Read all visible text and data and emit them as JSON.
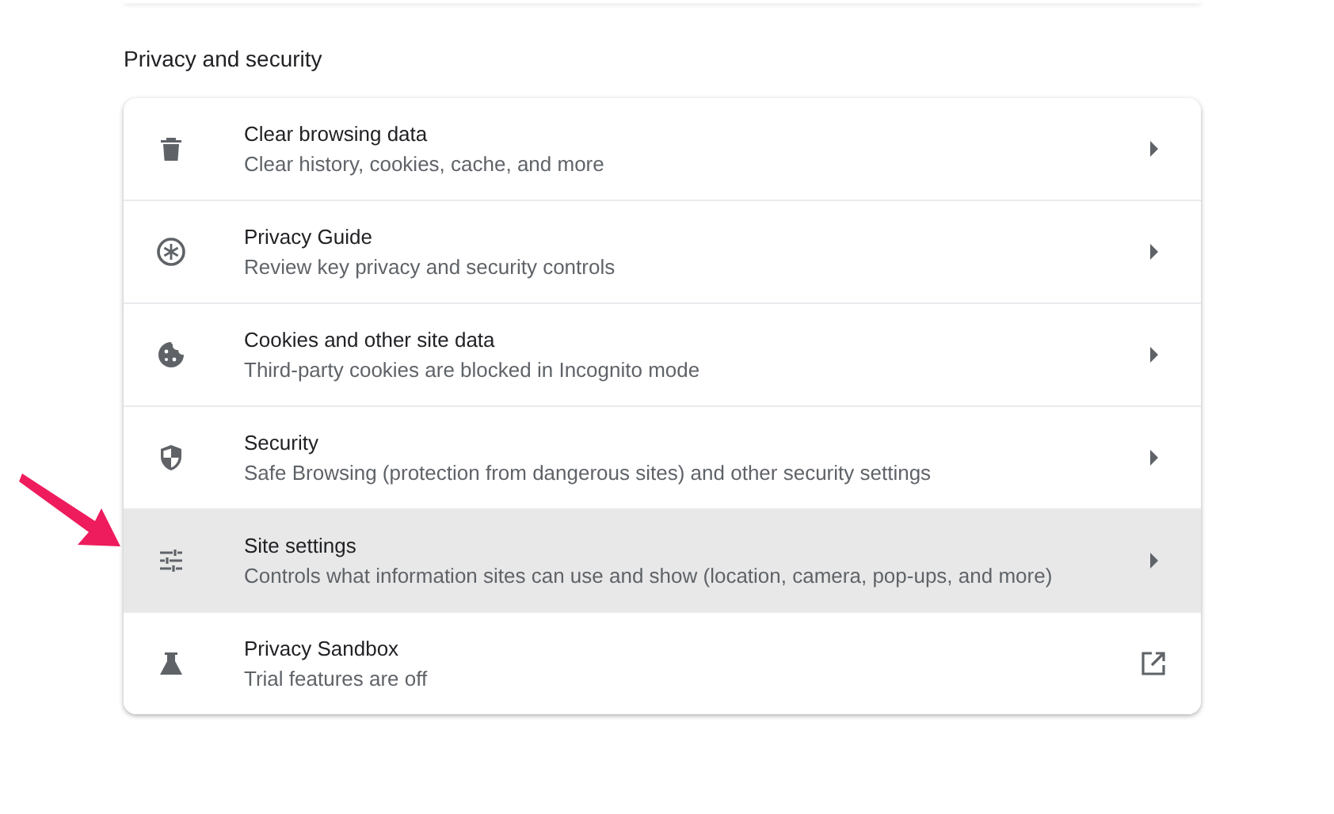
{
  "section": {
    "title": "Privacy and security"
  },
  "items": [
    {
      "kind": "subpage",
      "title": "Clear browsing data",
      "subtitle": "Clear history, cookies, cache, and more",
      "selected": false
    },
    {
      "kind": "subpage",
      "title": "Privacy Guide",
      "subtitle": "Review key privacy and security controls",
      "selected": false
    },
    {
      "kind": "subpage",
      "title": "Cookies and other site data",
      "subtitle": "Third-party cookies are blocked in Incognito mode",
      "selected": false
    },
    {
      "kind": "subpage",
      "title": "Security",
      "subtitle": "Safe Browsing (protection from dangerous sites) and other security settings",
      "selected": false
    },
    {
      "kind": "subpage",
      "title": "Site settings",
      "subtitle": "Controls what information sites can use and show (location, camera, pop-ups, and more)",
      "selected": true
    },
    {
      "kind": "external",
      "title": "Privacy Sandbox",
      "subtitle": "Trial features are off",
      "selected": false
    }
  ]
}
